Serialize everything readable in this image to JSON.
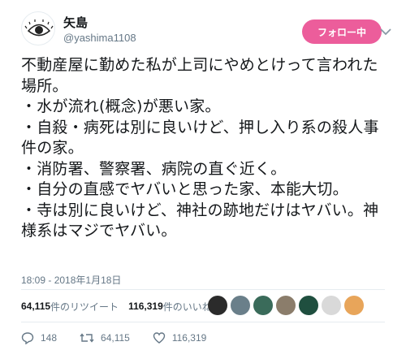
{
  "user": {
    "display_name": "矢島",
    "handle": "@yashima1108"
  },
  "follow_button": {
    "label": "フォロー中"
  },
  "tweet": {
    "text": "不動産屋に勤めた私が上司にやめとけって言われた場所。\n・水が流れ(概念)が悪い家。\n・自殺・病死は別に良いけど、押し入り系の殺人事件の家。\n・消防署、警察署、病院の直ぐ近く。\n・自分の直感でヤバいと思った家、本能大切。\n・寺は別に良いけど、神社の跡地だけはヤバい。神様系はマジでヤバい。",
    "timestamp": "18:09 - 2018年1月18日"
  },
  "stats": {
    "retweets_count": "64,115",
    "retweets_label": "件のリツイート",
    "likes_count": "116,319",
    "likes_label": "件のいいね"
  },
  "likers": {
    "colors": [
      "#2b2b2b",
      "#6a7f8a",
      "#3a6b5a",
      "#8b7d6b",
      "#1f4f3f",
      "#d9d9d9",
      "#e8a55a"
    ]
  },
  "actions": {
    "reply_count": "148",
    "retweet_count": "64,115",
    "like_count": "116,319"
  },
  "colors": {
    "follow_button": "#ec5d9b",
    "text_primary": "#14171a",
    "text_secondary": "#657786"
  }
}
